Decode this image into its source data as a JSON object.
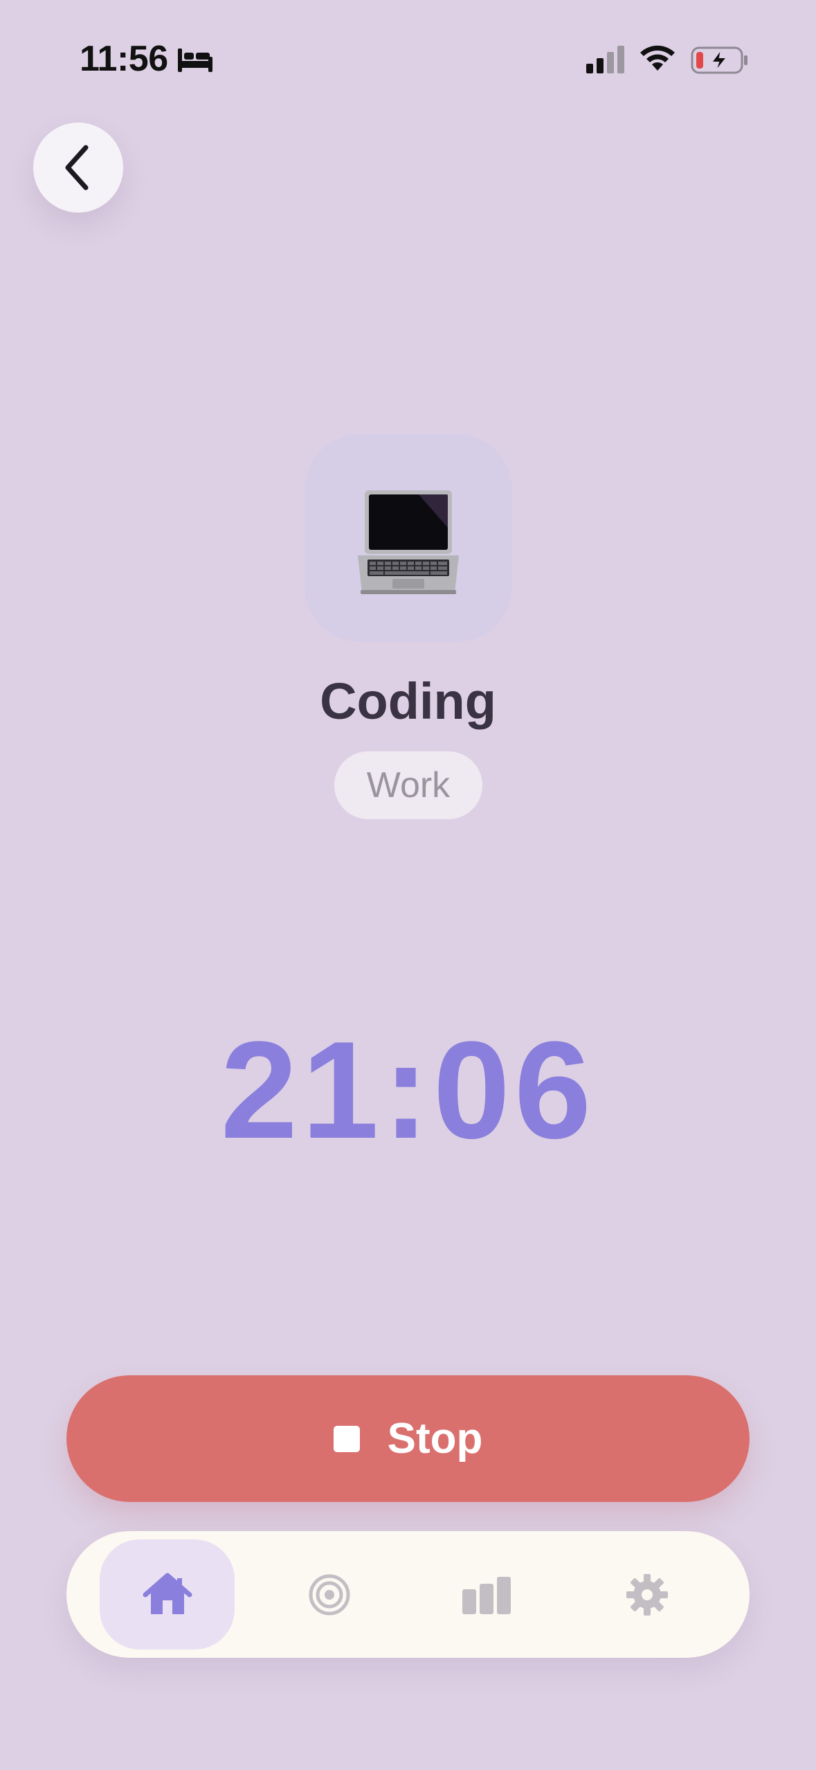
{
  "status_bar": {
    "time": "11:56",
    "focus_icon": "bed-icon",
    "signal_icon": "cellular-signal-icon",
    "wifi_icon": "wifi-icon",
    "battery_icon": "battery-charging-icon"
  },
  "nav": {
    "back_icon": "chevron-left-icon"
  },
  "activity": {
    "emoji": "💻",
    "name": "Coding",
    "category": "Work"
  },
  "timer": {
    "display": "21:06"
  },
  "stop_button": {
    "label": "Stop",
    "icon": "stop-square-icon"
  },
  "tab_bar": {
    "tabs": [
      {
        "icon": "home-icon",
        "active": true
      },
      {
        "icon": "target-icon",
        "active": false
      },
      {
        "icon": "bar-chart-icon",
        "active": false
      },
      {
        "icon": "gear-icon",
        "active": false
      }
    ]
  },
  "colors": {
    "background": "#ddd0e4",
    "accent": "#8a7fdc",
    "stop": "#da706e",
    "tab_bar": "#fcf8f2"
  }
}
